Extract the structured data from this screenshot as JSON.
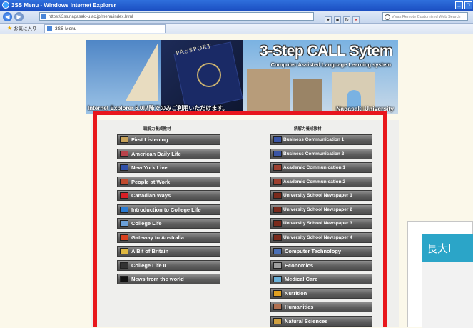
{
  "window": {
    "title": "3SS Menu - Windows Internet Explorer",
    "minimize_glyph": "_",
    "maximize_glyph": "□"
  },
  "navbar": {
    "back_glyph": "◀",
    "forward_glyph": "▶",
    "address": "https://3ss.nagasaki-u.ac.jp/menu/index.html",
    "search_placeholder": "Vivas Remote Customized Web Search"
  },
  "favbar": {
    "favorites_label": "お気に入り",
    "tab_label": "3SS Menu"
  },
  "banner": {
    "title": "3-Step CALL Sytem",
    "subtitle": "Computer-Assisted Language Learning system",
    "notice": "Internet Explorer 6.0以降でのみご利用いただけます。",
    "university": "Nagasaki University",
    "passport_text": "PASSPORT"
  },
  "columns": {
    "left_header": "聴解力養成教材",
    "right_header": "読解力養成教材"
  },
  "left_items": [
    {
      "label": "First Listening",
      "icon": "book-icon",
      "color": "#c7a25a"
    },
    {
      "label": "American Daily Life",
      "icon": "us-flag-icon",
      "color": "#b8434b"
    },
    {
      "label": "New York Live",
      "icon": "us-flag-icon",
      "color": "#3050a8"
    },
    {
      "label": "People at Work",
      "icon": "worker-icon",
      "color": "#c04a2d"
    },
    {
      "label": "Canadian Ways",
      "icon": "canada-flag-icon",
      "color": "#d81f26"
    },
    {
      "label": "Introduction to College Life",
      "icon": "college-icon",
      "color": "#2b7bd1"
    },
    {
      "label": "College Life",
      "icon": "campus-icon",
      "color": "#6ba0d8"
    },
    {
      "label": "Gateway to Australia",
      "icon": "australia-icon",
      "color": "#d8401e"
    },
    {
      "label": "A Bit of Britain",
      "icon": "britain-icon",
      "color": "#e0b840"
    },
    {
      "label": "College Life II",
      "icon": "campus-icon",
      "color": "#333333"
    },
    {
      "label": "News from the world",
      "icon": "news-icon",
      "color": "#111111"
    }
  ],
  "right_items": [
    {
      "label": "Business Communication 1",
      "icon": "business-icon",
      "color": "#3a55a5",
      "small": true
    },
    {
      "label": "Business Communication 2",
      "icon": "business-icon",
      "color": "#3a55a5",
      "small": true
    },
    {
      "label": "Academic Communication 1",
      "icon": "academic-icon",
      "color": "#9c3f2f",
      "small": true
    },
    {
      "label": "Academic Communication 2",
      "icon": "academic-icon",
      "color": "#9c3f2f",
      "small": true
    },
    {
      "label": "University School Newspaper 1",
      "icon": "newspaper-icon",
      "color": "#7a2a1c",
      "small": true
    },
    {
      "label": "University School Newspaper 2",
      "icon": "newspaper-icon",
      "color": "#7a2a1c",
      "small": true
    },
    {
      "label": "University School Newspaper 3",
      "icon": "newspaper-icon",
      "color": "#7a2a1c",
      "small": true
    },
    {
      "label": "University School Newspaper 4",
      "icon": "newspaper-icon",
      "color": "#7a2a1c",
      "small": true
    },
    {
      "label": "Computer Technology",
      "icon": "computer-icon",
      "color": "#4a6fb5"
    },
    {
      "label": "Economics",
      "icon": "economics-icon",
      "color": "#9e9e9e"
    },
    {
      "label": "Medical Care",
      "icon": "medical-icon",
      "color": "#6ab0d8"
    },
    {
      "label": "Nutrition",
      "icon": "nutrition-icon",
      "color": "#e0a020"
    },
    {
      "label": "Humanities",
      "icon": "humanities-icon",
      "color": "#b07050"
    },
    {
      "label": "Natural Sciences",
      "icon": "science-icon",
      "color": "#d0a040"
    }
  ],
  "popup": {
    "heading": "長大I"
  },
  "colors": {
    "highlight_border": "#e8171c",
    "page_bg": "#fbf8ea"
  }
}
